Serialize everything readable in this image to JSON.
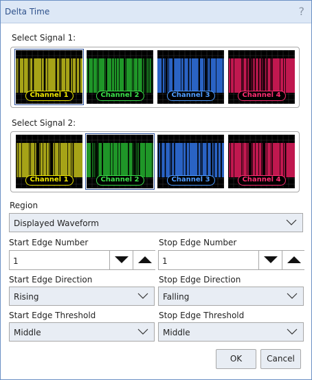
{
  "dialog": {
    "title": "Delta Time",
    "help_glyph": "?"
  },
  "signal1": {
    "label": "Select Signal 1:",
    "selected": 0,
    "channels": [
      {
        "label": "Channel 1",
        "color": "#a6a317",
        "pill_color": "#f0e800"
      },
      {
        "label": "Channel 2",
        "color": "#1f9628",
        "pill_color": "#3be04a"
      },
      {
        "label": "Channel 3",
        "color": "#2a63c4",
        "pill_color": "#4f9cff"
      },
      {
        "label": "Channel 4",
        "color": "#c0184f",
        "pill_color": "#ff2d72"
      }
    ]
  },
  "signal2": {
    "label": "Select Signal 2:",
    "selected": 1,
    "channels": [
      {
        "label": "Channel 1",
        "color": "#a6a317",
        "pill_color": "#f0e800"
      },
      {
        "label": "Channel 2",
        "color": "#1f9628",
        "pill_color": "#3be04a"
      },
      {
        "label": "Channel 3",
        "color": "#2a63c4",
        "pill_color": "#4f9cff"
      },
      {
        "label": "Channel 4",
        "color": "#c0184f",
        "pill_color": "#ff2d72"
      }
    ]
  },
  "region": {
    "label": "Region",
    "value": "Displayed Waveform"
  },
  "start_edge_number": {
    "label": "Start Edge Number",
    "value": "1"
  },
  "stop_edge_number": {
    "label": "Stop Edge Number",
    "value": "1"
  },
  "start_edge_direction": {
    "label": "Start Edge Direction",
    "value": "Rising"
  },
  "stop_edge_direction": {
    "label": "Stop Edge Direction",
    "value": "Falling"
  },
  "start_edge_threshold": {
    "label": "Start Edge Threshold",
    "value": "Middle"
  },
  "stop_edge_threshold": {
    "label": "Stop Edge Threshold",
    "value": "Middle"
  },
  "buttons": {
    "ok": "OK",
    "cancel": "Cancel"
  },
  "icons": {
    "help": "help-icon",
    "dropdown": "chevron-down-icon",
    "decrement": "arrow-down-icon",
    "increment": "arrow-up-icon"
  }
}
